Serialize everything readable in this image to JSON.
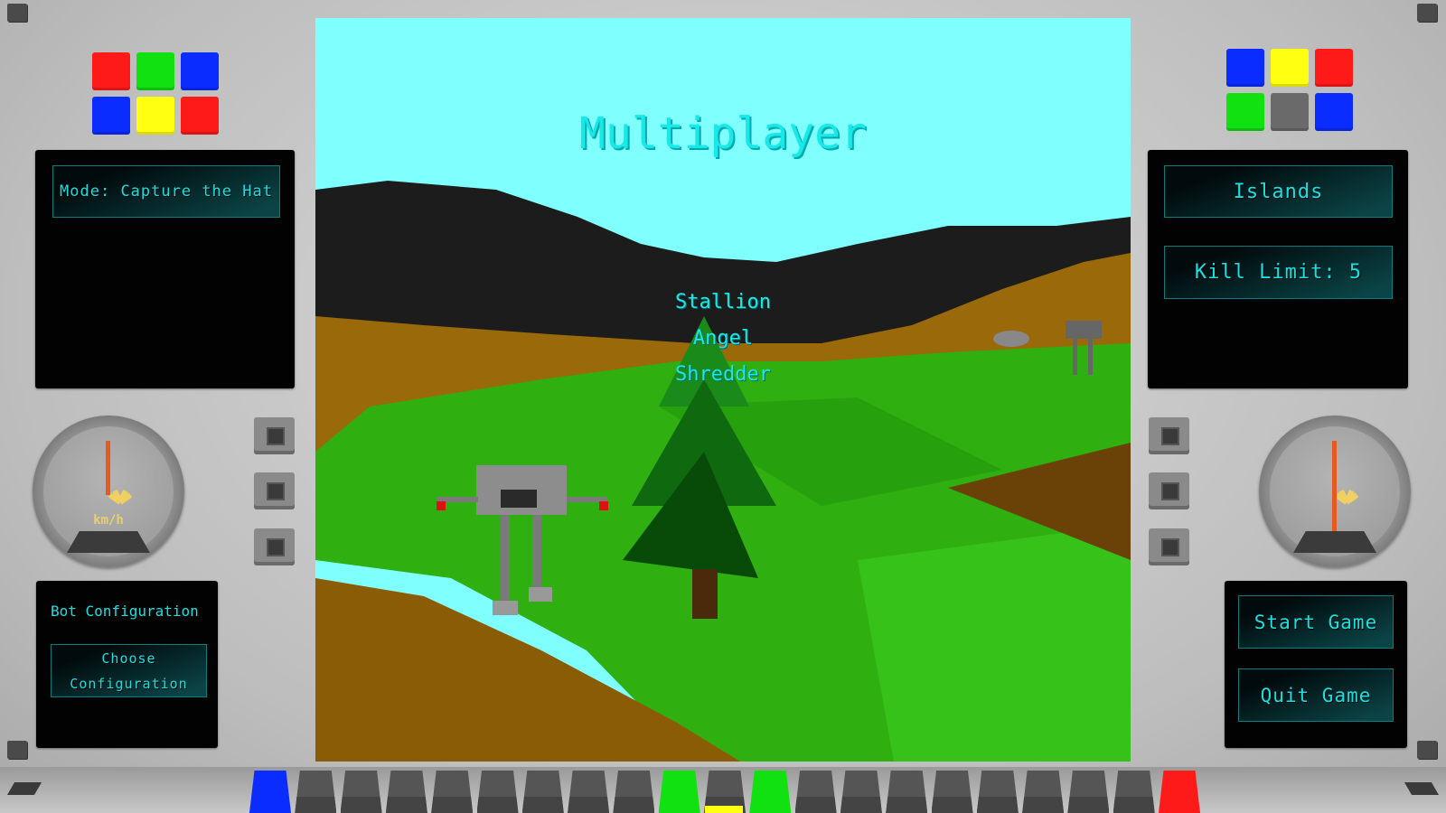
{
  "title": "Multiplayer",
  "players": [
    "Stallion",
    "Angel",
    "Shredder"
  ],
  "left_panel": {
    "mode_button": "Mode: Capture the Hat"
  },
  "right_panel": {
    "map_button": "Islands",
    "kill_limit_button": "Kill Limit: 5"
  },
  "bot_panel": {
    "heading": "Bot Configuration",
    "choose_button": "Choose Configuration"
  },
  "actions": {
    "start": "Start Game",
    "quit": "Quit Game"
  },
  "gauge": {
    "unit": "km/h"
  },
  "colors": {
    "left_grid": [
      "#ff1a1a",
      "#11e011",
      "#0a2cff",
      "#0a2cff",
      "#ffff11",
      "#ff1a1a"
    ],
    "right_grid": [
      "#0a2cff",
      "#ffff11",
      "#ff1a1a",
      "#11e011",
      "#6a6a6a",
      "#0a2cff"
    ],
    "keys": [
      "#0a2cff",
      "#555",
      "#555",
      "#555",
      "#555",
      "#555",
      "#555",
      "#555",
      "#555",
      "#11e011",
      "#555",
      "#11e011",
      "#555",
      "#555",
      "#555",
      "#555",
      "#555",
      "#555",
      "#555",
      "#555",
      "#ff1a1a"
    ],
    "text": "#19e0e0"
  }
}
